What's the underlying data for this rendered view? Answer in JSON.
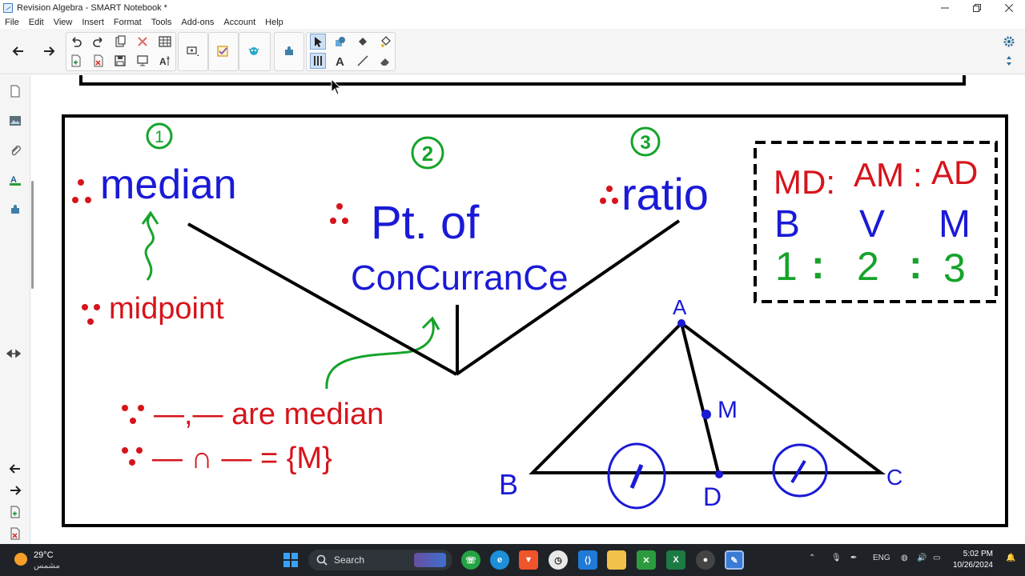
{
  "window": {
    "title": "Revision Algebra - SMART Notebook *",
    "minimize_icon": "minimize-icon",
    "maximize_icon": "restore-icon",
    "close_icon": "close-icon"
  },
  "menu": [
    "File",
    "Edit",
    "View",
    "Insert",
    "Format",
    "Tools",
    "Add-ons",
    "Account",
    "Help"
  ],
  "toolbar": {
    "back_icon": "arrow-left-icon",
    "forward_icon": "arrow-right-icon",
    "tools": [
      "undo-icon",
      "redo-icon",
      "paste-icon",
      "delete-icon",
      "table-icon",
      "add-page-icon",
      "delete-page-icon",
      "save-icon",
      "screen-shade-icon",
      "properties-icon",
      "display-icon",
      "response-icon",
      "lab-icon",
      "addon-icon",
      "select-icon",
      "shapes-icon",
      "fill-icon",
      "magic-pen-icon",
      "pens-icon",
      "text-icon",
      "line-icon",
      "eraser-icon"
    ],
    "settings_icon": "gear-icon",
    "move_toolbar_icon": "move-vertical-icon"
  },
  "sidebar": {
    "tabs": [
      "page-sorter-icon",
      "gallery-icon",
      "attachments-icon",
      "properties-icon",
      "addons-icon"
    ],
    "move_icon": "move-horizontal-icon",
    "bottom": [
      "prev-page-icon",
      "next-page-icon",
      "add-page-icon",
      "delete-page-icon"
    ]
  },
  "board": {
    "num1": "1",
    "num2": "2",
    "num3": "3",
    "median": "median",
    "pt_of": "Pt. of",
    "concurrance": "ConCurranCe",
    "ratio": "ratio",
    "midpoint": "midpoint",
    "are_median": "—,— are median",
    "intersection": "— ∩ — = {M}",
    "box_row1": [
      "MD:",
      "AM",
      ":",
      "AD"
    ],
    "box_row2": [
      "B",
      "V",
      "M"
    ],
    "box_row3": [
      "1",
      ":",
      "2",
      ":",
      "3"
    ],
    "labels": {
      "A": "A",
      "B": "B",
      "C": "C",
      "D": "D",
      "M": "M"
    },
    "colors": {
      "blue": "#1a1ad6",
      "red": "#d6141c",
      "green": "#16a32a",
      "black": "#000000"
    }
  },
  "taskbar": {
    "temperature": "29°C",
    "condition": "مشمس",
    "search_placeholder": "Search",
    "language": "ENG",
    "time": "5:02 PM",
    "date": "10/26/2024",
    "apps": [
      "windows-start-icon",
      "widgets-icon",
      "whatsapp-icon",
      "edge-icon",
      "brave-icon",
      "clock-app-icon",
      "vscode-icon",
      "file-explorer-icon",
      "xbox-icon",
      "excel-icon",
      "obs-icon",
      "smart-notebook-icon"
    ]
  }
}
